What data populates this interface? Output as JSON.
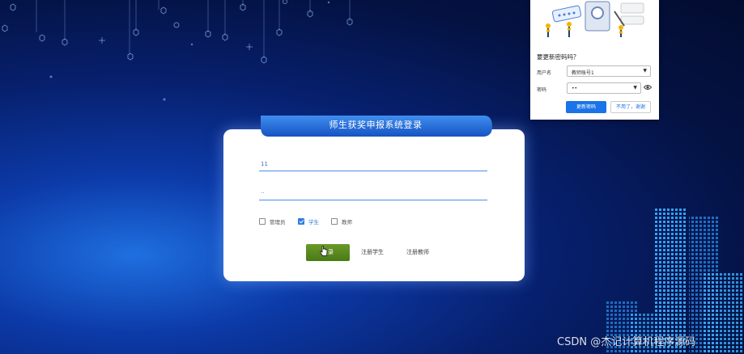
{
  "login": {
    "title": "师生获奖申报系统登录",
    "username_value": "11",
    "password_value": "··",
    "roles": [
      {
        "label": "管理员",
        "checked": false
      },
      {
        "label": "学生",
        "checked": true
      },
      {
        "label": "教师",
        "checked": false
      }
    ],
    "login_button": "登录",
    "register_student": "注册学生",
    "register_teacher": "注册教师"
  },
  "password_popup": {
    "question": "要更新密码吗？",
    "username_label": "用户名",
    "username_value": "教师账号1",
    "password_label": "密码",
    "password_value": "••",
    "update_button": "更新密码",
    "dismiss_button": "不用了，谢谢"
  },
  "watermark": "CSDN @杰记计算机程序源码",
  "colors": {
    "accent": "#1a73e8",
    "login_button": "#5a8a1e",
    "field_line": "#4d8fe8",
    "background": "#07206e"
  }
}
